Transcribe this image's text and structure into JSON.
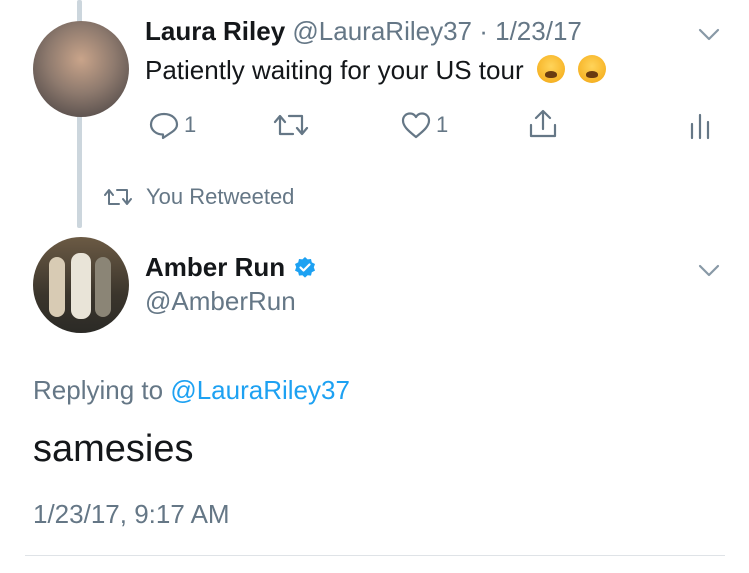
{
  "tweet1": {
    "display_name": "Laura Riley",
    "handle_date": "@LauraRiley37 · 1/23/17",
    "text": "Patiently waiting for your US tour",
    "emoji": [
      "weary-face-emoji",
      "weary-face-emoji"
    ],
    "reply_count": "1",
    "like_count": "1"
  },
  "retweet_context": {
    "label": "You Retweeted"
  },
  "tweet2": {
    "display_name": "Amber Run",
    "handle": "@AmberRun",
    "replying_prefix": "Replying to",
    "replying_handle": "@LauraRiley37",
    "text": "samesies",
    "timestamp": "1/23/17, 9:17 AM"
  },
  "colors": {
    "accent": "#1da1f2",
    "muted": "#657786",
    "divider": "#dfe3e7",
    "thread_line": "#ccd6dd"
  }
}
